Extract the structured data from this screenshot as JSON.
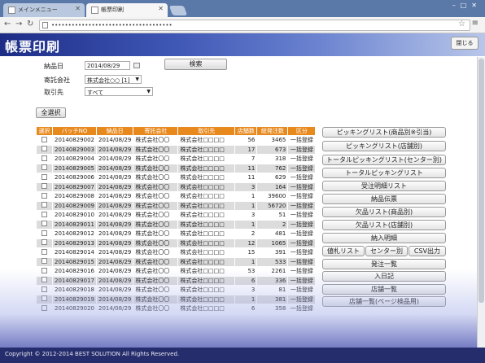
{
  "browser": {
    "tabs": [
      {
        "label": "メインメニュー"
      },
      {
        "label": "帳票印刷"
      }
    ],
    "url": "••••••••••••••••••••••••••••••••••••"
  },
  "header": {
    "title": "帳票印刷",
    "close_label": "閉じる"
  },
  "form": {
    "date_label": "納品日",
    "date_value": "2014/08/29",
    "consignor_label": "寄託会社",
    "consignor_value": "株式会社○○ [1]",
    "client_label": "取引先",
    "client_value": "すべて",
    "search_label": "検索",
    "select_all_label": "全選択"
  },
  "table": {
    "headers": [
      "選択",
      "バッチNO",
      "納品日",
      "寄託会社",
      "取引先",
      "店舗数",
      "総発注数",
      "区分"
    ],
    "rows": [
      {
        "batch": "20140829002",
        "date": "2014/08/29",
        "consignor": "株式会社〇〇",
        "client": "株式会社□□□□",
        "stores": "56",
        "orders": "3465",
        "type": "一括登録"
      },
      {
        "batch": "20140829003",
        "date": "2014/08/29",
        "consignor": "株式会社〇〇",
        "client": "株式会社□□□□",
        "stores": "17",
        "orders": "673",
        "type": "一括登録"
      },
      {
        "batch": "20140829004",
        "date": "2014/08/29",
        "consignor": "株式会社〇〇",
        "client": "株式会社□□□□",
        "stores": "7",
        "orders": "318",
        "type": "一括登録"
      },
      {
        "batch": "20140829005",
        "date": "2014/08/29",
        "consignor": "株式会社〇〇",
        "client": "株式会社□□□□",
        "stores": "11",
        "orders": "762",
        "type": "一括登録"
      },
      {
        "batch": "20140829006",
        "date": "2014/08/29",
        "consignor": "株式会社〇〇",
        "client": "株式会社□□□□",
        "stores": "11",
        "orders": "629",
        "type": "一括登録"
      },
      {
        "batch": "20140829007",
        "date": "2014/08/29",
        "consignor": "株式会社〇〇",
        "client": "株式会社□□□□",
        "stores": "3",
        "orders": "164",
        "type": "一括登録"
      },
      {
        "batch": "20140829008",
        "date": "2014/08/29",
        "consignor": "株式会社〇〇",
        "client": "株式会社□□□□",
        "stores": "1",
        "orders": "39600",
        "type": "一括登録"
      },
      {
        "batch": "20140829009",
        "date": "2014/08/29",
        "consignor": "株式会社〇〇",
        "client": "株式会社□□□□",
        "stores": "1",
        "orders": "56720",
        "type": "一括登録"
      },
      {
        "batch": "20140829010",
        "date": "2014/08/29",
        "consignor": "株式会社〇〇",
        "client": "株式会社□□□□",
        "stores": "3",
        "orders": "51",
        "type": "一括登録"
      },
      {
        "batch": "20140829011",
        "date": "2014/08/29",
        "consignor": "株式会社〇〇",
        "client": "株式会社□□□□",
        "stores": "1",
        "orders": "2",
        "type": "一括登録"
      },
      {
        "batch": "20140829012",
        "date": "2014/08/29",
        "consignor": "株式会社〇〇",
        "client": "株式会社□□□□",
        "stores": "2",
        "orders": "481",
        "type": "一括登録"
      },
      {
        "batch": "20140829013",
        "date": "2014/08/29",
        "consignor": "株式会社〇〇",
        "client": "株式会社□□□□",
        "stores": "12",
        "orders": "1065",
        "type": "一括登録"
      },
      {
        "batch": "20140829014",
        "date": "2014/08/29",
        "consignor": "株式会社〇〇",
        "client": "株式会社□□□□",
        "stores": "15",
        "orders": "391",
        "type": "一括登録"
      },
      {
        "batch": "20140829015",
        "date": "2014/08/29",
        "consignor": "株式会社〇〇",
        "client": "株式会社□□□□",
        "stores": "1",
        "orders": "533",
        "type": "一括登録"
      },
      {
        "batch": "20140829016",
        "date": "2014/08/29",
        "consignor": "株式会社〇〇",
        "client": "株式会社□□□□",
        "stores": "53",
        "orders": "2261",
        "type": "一括登録"
      },
      {
        "batch": "20140829017",
        "date": "2014/08/29",
        "consignor": "株式会社〇〇",
        "client": "株式会社□□□□",
        "stores": "6",
        "orders": "336",
        "type": "一括登録"
      },
      {
        "batch": "20140829018",
        "date": "2014/08/29",
        "consignor": "株式会社〇〇",
        "client": "株式会社□□□□",
        "stores": "3",
        "orders": "81",
        "type": "一括登録"
      },
      {
        "batch": "20140829019",
        "date": "2014/08/29",
        "consignor": "株式会社〇〇",
        "client": "株式会社□□□□",
        "stores": "1",
        "orders": "381",
        "type": "一括登録"
      },
      {
        "batch": "20140829020",
        "date": "2014/08/29",
        "consignor": "株式会社〇〇",
        "client": "株式会社□□□□",
        "stores": "6",
        "orders": "358",
        "type": "一括登録"
      }
    ]
  },
  "report_buttons": {
    "picking_list_product": "ピッキングリスト(商品別※引当)",
    "picking_list_store": "ピッキングリスト(店舗別)",
    "total_picking_center": "トータルピッキングリスト(センター別)",
    "total_picking": "トータルピッキングリスト",
    "order_detail": "受注明細リスト",
    "delivery_slip": "納品伝票",
    "shortage_product": "欠品リスト(商品別)",
    "shortage_store": "欠品リスト(店舗別)",
    "delivery_detail": "納入明細",
    "price_tag": "値札リスト",
    "by_center": "センター別",
    "csv_output": "CSV出力",
    "shipping_list": "発注一覧",
    "daily_log": "入日記",
    "store_list": "店舗一覧",
    "store_list_inspection": "店舗一覧(ページ検品用)"
  },
  "footer": {
    "copyright": "Copyright © 2012-2014 BEST SOLUTION All Rights Reserved."
  }
}
